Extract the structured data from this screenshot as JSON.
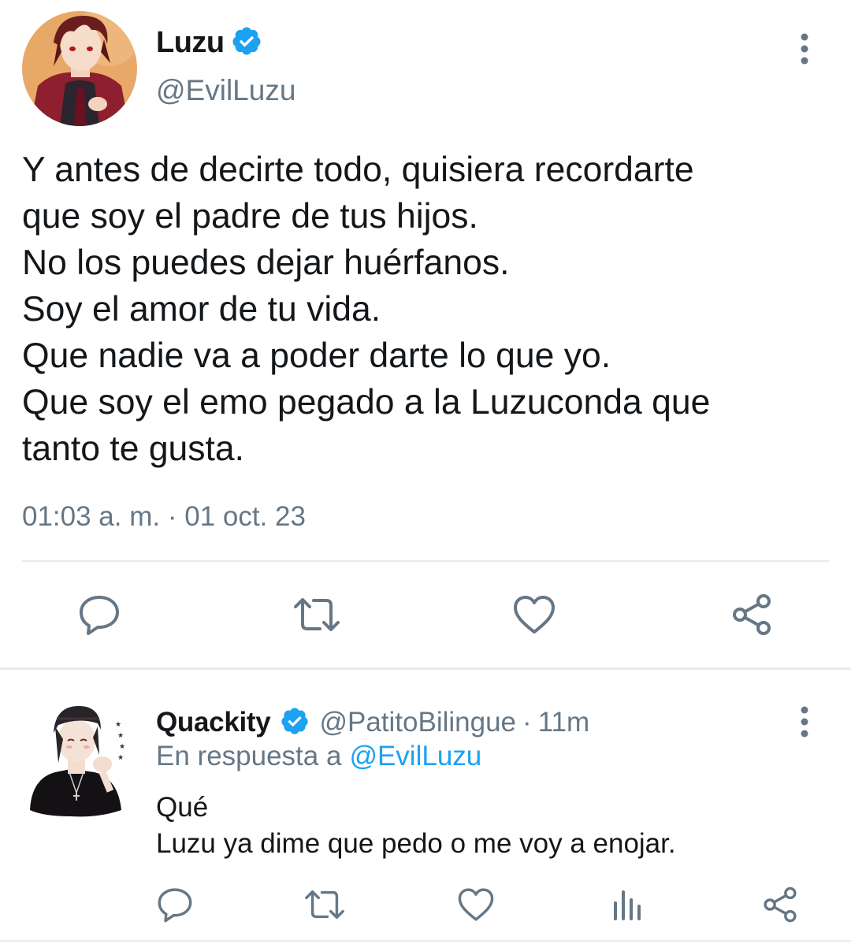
{
  "tweet": {
    "display_name": "Luzu",
    "handle": "@EvilLuzu",
    "verified": true,
    "text_lines": [
      "Y antes de decirte todo, quisiera recordarte",
      "que soy el padre de tus hijos.",
      "No los puedes dejar huérfanos.",
      "Soy el amor de tu vida.",
      "Que nadie va a poder darte lo que yo.",
      "Que soy el emo pegado a la Luzuconda que",
      "tanto te gusta."
    ],
    "timestamp": "01:03 a. m. · 01 oct. 23",
    "actions": [
      "reply-icon",
      "retweet-icon",
      "like-icon",
      "share-icon"
    ]
  },
  "reply": {
    "display_name": "Quackity",
    "verified": true,
    "handle": "@PatitoBilingue",
    "separator": "·",
    "time": "11m",
    "replying_label": "En respuesta a",
    "replying_mention": "@EvilLuzu",
    "text_lines": [
      "Qué",
      "Luzu ya dime que pedo o me voy a enojar."
    ],
    "actions": [
      "reply-icon",
      "retweet-icon",
      "like-icon",
      "analytics-icon",
      "share-icon"
    ]
  },
  "colors": {
    "text_primary": "#14171a",
    "text_secondary": "#657786",
    "accent": "#1da1f2",
    "divider": "#e6ecf0",
    "verified_badge": "#1da1f2"
  }
}
